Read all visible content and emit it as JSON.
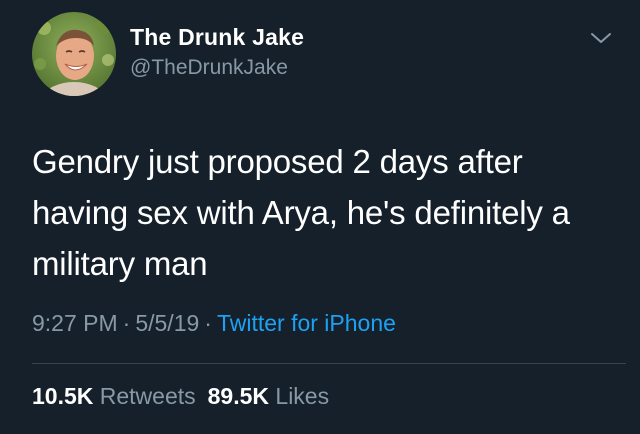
{
  "user": {
    "display_name": "The Drunk Jake",
    "handle": "@TheDrunkJake"
  },
  "tweet": {
    "lines": [
      "Gendry just proposed 2 days after",
      "having sex with Arya, he's definitely a",
      "military man"
    ]
  },
  "meta": {
    "time": "9:27 PM",
    "separator": "·",
    "date": "5/5/19",
    "source": "Twitter for iPhone"
  },
  "stats": {
    "retweets_count": "10.5K",
    "retweets_label": "Retweets",
    "likes_count": "89.5K",
    "likes_label": "Likes"
  },
  "colors": {
    "background": "#15202b",
    "primary_text": "#ffffff",
    "secondary_text": "#8899a6",
    "link": "#1da1f2",
    "divider": "#38444d"
  },
  "icons": {
    "menu": "chevron-down-icon"
  }
}
